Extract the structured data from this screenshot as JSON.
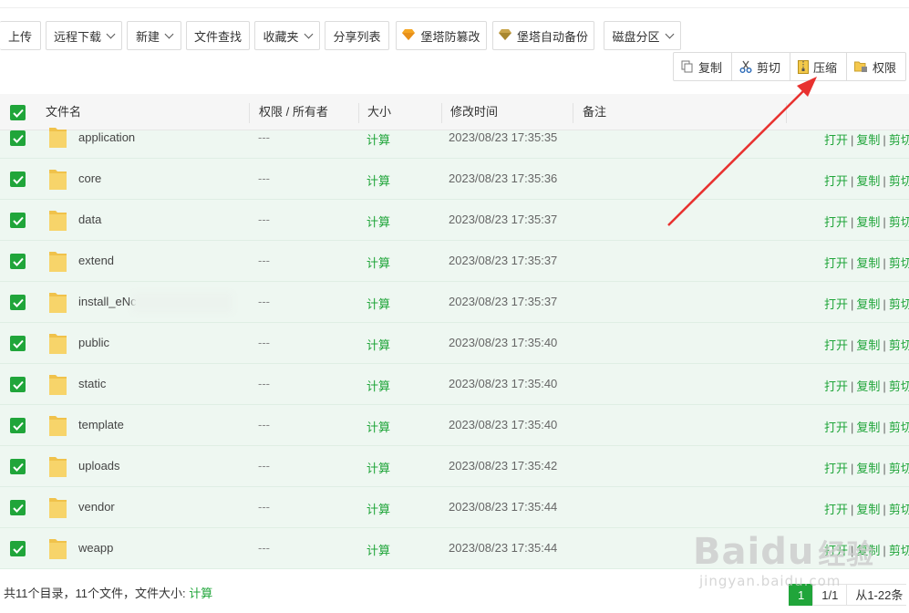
{
  "toolbar": {
    "upload": "上传",
    "remote_download": "远程下载",
    "new": "新建",
    "file_search": "文件查找",
    "favorites": "收藏夹",
    "share_list": "分享列表",
    "tamper_proof": "堡塔防篡改",
    "auto_backup": "堡塔自动备份",
    "disk_partition": "磁盘分区"
  },
  "batch_ops": {
    "copy": "复制",
    "cut": "剪切",
    "compress": "压缩",
    "permission": "权限"
  },
  "table": {
    "headers": {
      "filename": "文件名",
      "perm_owner": "权限 / 所有者",
      "size": "大小",
      "mtime": "修改时间",
      "remark": "备注"
    },
    "rows": [
      {
        "name": "application",
        "perm": "---",
        "size": "计算",
        "mtime": "2023/08/23 17:35:35",
        "checked": true
      },
      {
        "name": "core",
        "perm": "---",
        "size": "计算",
        "mtime": "2023/08/23 17:35:36",
        "checked": true
      },
      {
        "name": "data",
        "perm": "---",
        "size": "计算",
        "mtime": "2023/08/23 17:35:37",
        "checked": true
      },
      {
        "name": "extend",
        "perm": "---",
        "size": "计算",
        "mtime": "2023/08/23 17:35:37",
        "checked": true
      },
      {
        "name": "install_eNc",
        "perm": "---",
        "size": "计算",
        "mtime": "2023/08/23 17:35:37",
        "checked": true
      },
      {
        "name": "public",
        "perm": "---",
        "size": "计算",
        "mtime": "2023/08/23 17:35:40",
        "checked": true
      },
      {
        "name": "static",
        "perm": "---",
        "size": "计算",
        "mtime": "2023/08/23 17:35:40",
        "checked": true
      },
      {
        "name": "template",
        "perm": "---",
        "size": "计算",
        "mtime": "2023/08/23 17:35:40",
        "checked": true
      },
      {
        "name": "uploads",
        "perm": "---",
        "size": "计算",
        "mtime": "2023/08/23 17:35:42",
        "checked": true
      },
      {
        "name": "vendor",
        "perm": "---",
        "size": "计算",
        "mtime": "2023/08/23 17:35:44",
        "checked": true
      },
      {
        "name": "weapp",
        "perm": "---",
        "size": "计算",
        "mtime": "2023/08/23 17:35:44",
        "checked": true
      }
    ],
    "row_actions": {
      "open": "打开",
      "copy": "复制",
      "cut": "剪切",
      "separator": "|"
    }
  },
  "footer": {
    "summary": "共11个目录，11个文件，文件大小:",
    "calc": "计算"
  },
  "pager": {
    "current": "1",
    "pages": "1/1",
    "range": "从1-22条"
  },
  "watermark": {
    "brand": "Baidu",
    "brand_cn": "经验",
    "url": "jingyan.baidu.com"
  },
  "colors": {
    "accent": "#20a53a",
    "row_bg": "#eef7f1",
    "arrow": "#e8312f"
  },
  "icons": [
    "chevron-down-icon",
    "diamond-icon",
    "copy-icon",
    "scissors-icon",
    "zip-icon",
    "folder-lock-icon",
    "folder-icon",
    "check-icon"
  ]
}
